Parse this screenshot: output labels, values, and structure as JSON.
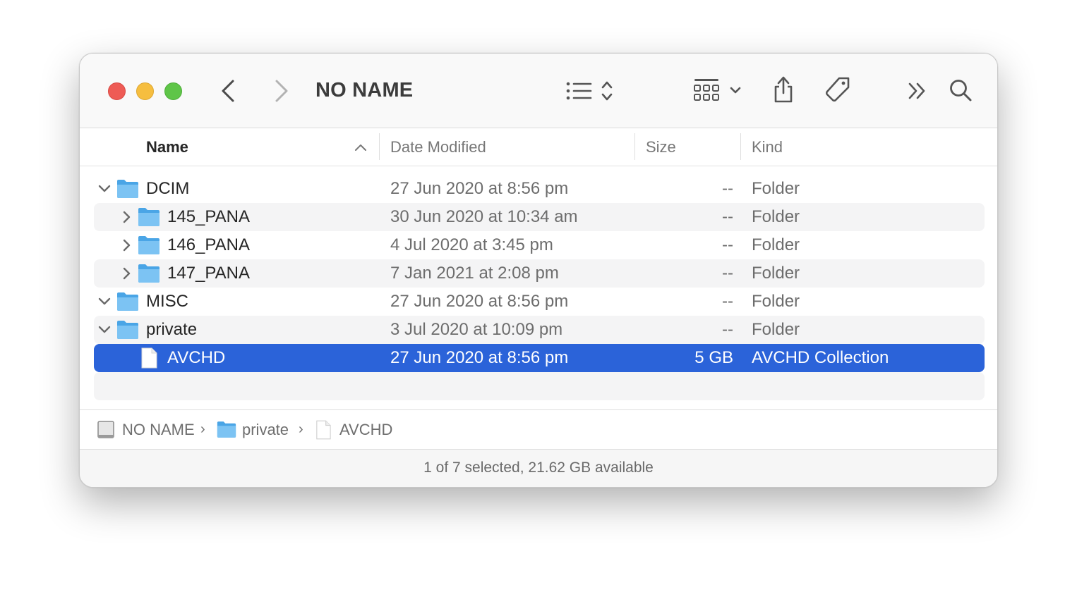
{
  "window": {
    "title": "NO NAME",
    "accent": "#2b63d9"
  },
  "toolbar": {
    "back_icon": "chevron-left-icon",
    "forward_icon": "chevron-right-icon",
    "view_icon": "list-view-icon",
    "group_icon": "grid-group-icon",
    "share_icon": "share-icon",
    "tag_icon": "tag-icon",
    "more_icon": "double-chevron-icon",
    "search_icon": "search-icon"
  },
  "columns": {
    "name": "Name",
    "date": "Date Modified",
    "size": "Size",
    "kind": "Kind",
    "sort": "ascending"
  },
  "rows": [
    {
      "name": "DCIM",
      "date": "27 Jun 2020 at 8:56 pm",
      "size": "--",
      "kind": "Folder"
    },
    {
      "name": "145_PANA",
      "date": "30 Jun 2020 at 10:34 am",
      "size": "--",
      "kind": "Folder"
    },
    {
      "name": "146_PANA",
      "date": "4 Jul 2020 at 3:45 pm",
      "size": "--",
      "kind": "Folder"
    },
    {
      "name": "147_PANA",
      "date": "7 Jan 2021 at 2:08 pm",
      "size": "--",
      "kind": "Folder"
    },
    {
      "name": "MISC",
      "date": "27 Jun 2020 at 8:56 pm",
      "size": "--",
      "kind": "Folder"
    },
    {
      "name": "private",
      "date": "3 Jul 2020 at 10:09 pm",
      "size": "--",
      "kind": "Folder"
    },
    {
      "name": "AVCHD",
      "date": "27 Jun 2020 at 8:56 pm",
      "size": "5 GB",
      "kind": "AVCHD Collection"
    }
  ],
  "pathbar": {
    "items": [
      "NO NAME",
      "private",
      "AVCHD"
    ]
  },
  "status": "1 of 7 selected, 21.62 GB available"
}
